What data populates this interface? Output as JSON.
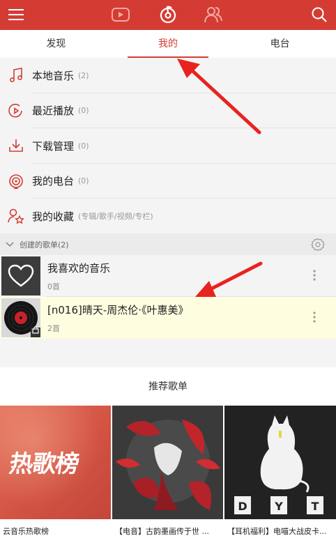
{
  "topbar": {
    "icons": [
      "menu-icon",
      "video-icon",
      "music-logo-icon",
      "friends-icon",
      "search-icon"
    ],
    "accent": "#d43c33"
  },
  "tabs": [
    {
      "label": "发现"
    },
    {
      "label": "我的",
      "active": true
    },
    {
      "label": "电台"
    }
  ],
  "menu": [
    {
      "label": "本地音乐",
      "count": "(2)",
      "icon": "music-note-icon"
    },
    {
      "label": "最近播放",
      "count": "(0)",
      "icon": "recent-play-icon"
    },
    {
      "label": "下载管理",
      "count": "(0)",
      "icon": "download-icon"
    },
    {
      "label": "我的电台",
      "count": "(0)",
      "icon": "radio-icon"
    },
    {
      "label": "我的收藏",
      "count": "(专辑/歌手/视频/专栏)",
      "icon": "collection-icon"
    }
  ],
  "created": {
    "title": "创建的歌单(2)",
    "playlists": [
      {
        "name": "我喜欢的音乐",
        "count": "0首"
      },
      {
        "name": "[n016]晴天-周杰伦·《叶惠美》",
        "count": "2首"
      }
    ]
  },
  "recommend": {
    "title": "推荐歌单",
    "cover_text": "热歌榜",
    "cover_letters": [
      "D",
      "Y",
      "T"
    ],
    "items": [
      {
        "caption": "云音乐热歌榜"
      },
      {
        "caption": "【电音】古韵墨画传于世 ..."
      },
      {
        "caption": "【耳机福利】电喵大战皮卡..."
      }
    ]
  }
}
